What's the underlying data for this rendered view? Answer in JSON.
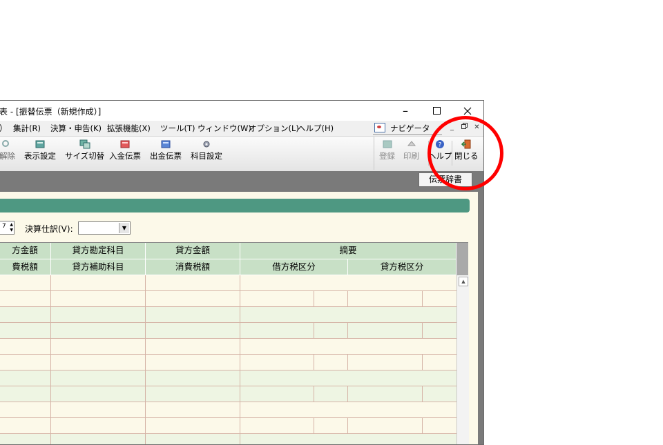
{
  "window": {
    "title": "表 - [振替伝票（新規作成）]",
    "minimize": "–",
    "maximize": "☐",
    "close": "✕"
  },
  "menu": {
    "items": [
      "）",
      "集計(R)",
      "決算・申告(K)",
      "拡張機能(X)",
      "ツール(T)",
      "ウィンドウ(W)",
      "オプション(L)",
      "ヘルプ(H)"
    ],
    "navigator": "ナビゲータ",
    "mdi_min": "_",
    "mdi_restore": "3",
    "mdi_close": "✕"
  },
  "toolbar": {
    "items": [
      "解除",
      "表示設定",
      "サイズ切替",
      "入金伝票",
      "出金伝票",
      "科目設定"
    ],
    "right": [
      "登録",
      "印刷",
      "ヘルプ",
      "閉じる"
    ]
  },
  "denpyo_button": "伝票辞書",
  "form": {
    "spin_value": "7",
    "kessan_label": "決算仕訳(V):",
    "kessan_value": ""
  },
  "grid": {
    "header_row1": [
      "方金額",
      "貸方勘定科目",
      "貸方金額",
      "摘要"
    ],
    "header_row2": [
      "費税額",
      "貸方補助科目",
      "消費税額",
      "借方税区分",
      "貸方税区分"
    ]
  },
  "colors": {
    "accent_green": "#4e9882",
    "header_green": "#c8e0c6",
    "highlight_circle": "#ff0000"
  }
}
